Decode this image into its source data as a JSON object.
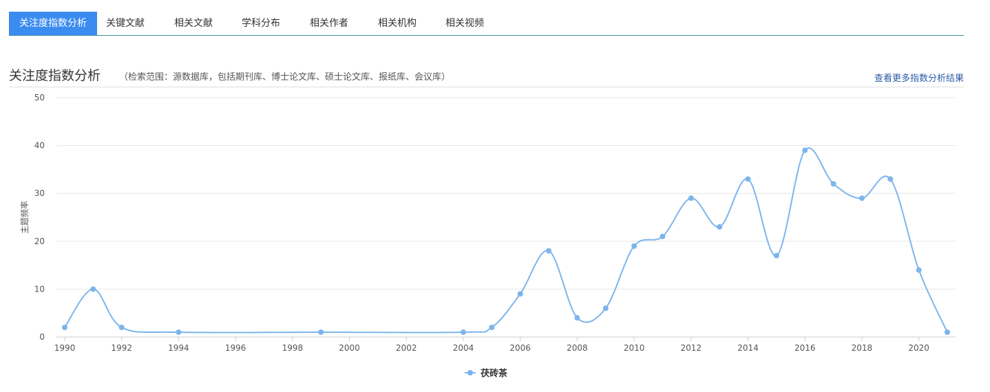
{
  "tabs": [
    {
      "label": "关注度指数分析",
      "active": true
    },
    {
      "label": "关键文献",
      "active": false
    },
    {
      "label": "相关文献",
      "active": false
    },
    {
      "label": "学科分布",
      "active": false
    },
    {
      "label": "相关作者",
      "active": false
    },
    {
      "label": "相关机构",
      "active": false
    },
    {
      "label": "相关视频",
      "active": false
    }
  ],
  "section": {
    "title": "关注度指数分析",
    "note": "（检索范围：源数据库，包括期刊库、博士论文库、硕士论文库、报纸库、会议库）",
    "link": "查看更多指数分析结果"
  },
  "colors": {
    "accent": "#3b8cf0",
    "series": "#7cb5ec",
    "link": "#2a5aa6"
  },
  "chart_data": {
    "type": "line",
    "ylabel": "主题频率",
    "xlabel": "",
    "ylim": [
      0,
      50
    ],
    "yticks": [
      0,
      10,
      20,
      30,
      40,
      50
    ],
    "xlim": [
      1990,
      2021
    ],
    "xticks": [
      1990,
      1992,
      1994,
      1996,
      1998,
      2000,
      2002,
      2004,
      2006,
      2008,
      2010,
      2012,
      2014,
      2016,
      2018,
      2020
    ],
    "grid": true,
    "legend": "bottom-center",
    "series": [
      {
        "name": "茯砖茶",
        "points": [
          [
            1990,
            2
          ],
          [
            1991,
            10
          ],
          [
            1992,
            2
          ],
          [
            1994,
            1
          ],
          [
            1999,
            1
          ],
          [
            2004,
            1
          ],
          [
            2005,
            2
          ],
          [
            2006,
            9
          ],
          [
            2007,
            18
          ],
          [
            2008,
            4
          ],
          [
            2009,
            6
          ],
          [
            2010,
            19
          ],
          [
            2011,
            21
          ],
          [
            2012,
            29
          ],
          [
            2013,
            23
          ],
          [
            2014,
            33
          ],
          [
            2015,
            17
          ],
          [
            2016,
            39
          ],
          [
            2017,
            32
          ],
          [
            2018,
            29
          ],
          [
            2019,
            33
          ],
          [
            2020,
            14
          ],
          [
            2021,
            1
          ]
        ]
      }
    ]
  }
}
